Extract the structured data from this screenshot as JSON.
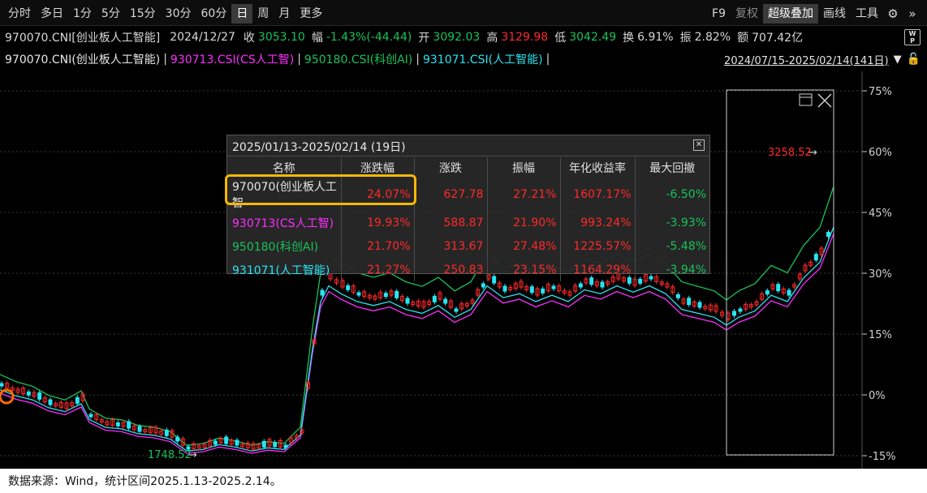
{
  "toolbar": {
    "period_tabs": [
      "分时",
      "多日",
      "1分",
      "5分",
      "15分",
      "30分",
      "60分",
      "日",
      "周",
      "月",
      "更多"
    ],
    "active_period": "日",
    "right_items": [
      "F9",
      "复权",
      "超级叠加",
      "画线",
      "工具"
    ],
    "active_right": "超级叠加"
  },
  "quote": {
    "code": "970070.CNI[创业板人工智能]",
    "date": "2024/12/27",
    "close_label": "收",
    "close": "3053.10",
    "change_label": "幅",
    "change": "-1.43%(-44.44)",
    "open_label": "开",
    "open": "3092.03",
    "high_label": "高",
    "high": "3129.98",
    "low_label": "低",
    "low": "3042.49",
    "turnover_label": "换",
    "turnover": "6.91%",
    "amplitude_label": "振",
    "amplitude": "2.82%",
    "amount_label": "额",
    "amount": "707.42亿"
  },
  "series_bar": {
    "items": [
      {
        "label": "970070.CNI(创业板人工智能)",
        "color": "#e8e8e8"
      },
      {
        "label": "930713.CSI(CS人工智)",
        "color": "#ff2cff"
      },
      {
        "label": "950180.CSI(科创AI)",
        "color": "#19c25a"
      },
      {
        "label": "931071.CSI(人工智能)",
        "color": "#29e4f2"
      }
    ],
    "range": "2024/07/15-2025/02/14(141日)"
  },
  "popup": {
    "title": "2025/01/13-2025/02/14 (19日)",
    "columns": [
      "名称",
      "涨跌幅",
      "涨跌",
      "振幅",
      "年化收益率",
      "最大回撤"
    ],
    "rows": [
      {
        "name": "970070(创业板人工智",
        "pct": "24.07%",
        "chg": "627.78",
        "amp": "27.21%",
        "annual": "1607.17%",
        "dd": "-6.50%",
        "color": "#e8e8e8"
      },
      {
        "name": "930713(CS人工智)",
        "pct": "19.93%",
        "chg": "588.87",
        "amp": "21.90%",
        "annual": "993.24%",
        "dd": "-3.93%",
        "color": "#ff2cff"
      },
      {
        "name": "950180(科创AI)",
        "pct": "21.70%",
        "chg": "313.67",
        "amp": "27.48%",
        "annual": "1225.57%",
        "dd": "-5.48%",
        "color": "#19c25a"
      },
      {
        "name": "931071(人工智能)",
        "pct": "21.27%",
        "chg": "250.83",
        "amp": "23.15%",
        "annual": "1164.29%",
        "dd": "-3.94%",
        "color": "#29e4f2"
      }
    ]
  },
  "chart": {
    "y_ticks": [
      "75%",
      "60%",
      "45%",
      "30%",
      "15%",
      "0%",
      "-15%"
    ],
    "annotation_low": "1748.52",
    "annotation_high": "3258.52"
  },
  "source_note": "数据来源：Wind，统计区间2025.1.13-2025.2.14。"
}
